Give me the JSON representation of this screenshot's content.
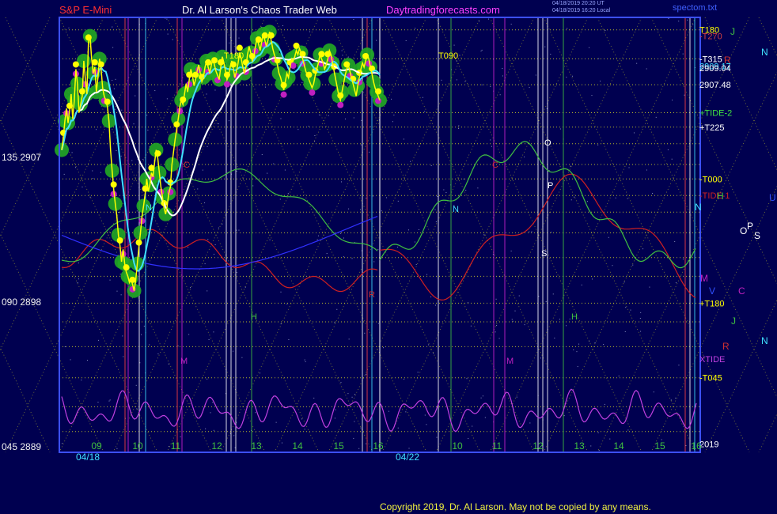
{
  "header": {
    "instrument": "S&P E-Mini",
    "site": "Dr. Al Larson's Chaos Trader Web",
    "url": "Daytradingforecasts.com",
    "stamp1": "04/18/2019 20:20 UT",
    "stamp2": "04/18/2019 16:20 Local",
    "file": "spectom.txt"
  },
  "copyright": "Copyright 2019, Dr. Al Larson. May not be copied by any means.",
  "colors": {
    "background": "#000050",
    "plot_border": "#3c50ff",
    "price_bar": "#ffff00",
    "bubble_green": "#22aa22",
    "bubble_yellow": "#ffff00",
    "bubble_magenta": "#c020c0",
    "ma_white": "#ffffff",
    "ma_cyan": "#40e0ff",
    "tide_red": "#d02020",
    "tide_green": "#40c040",
    "tide_blue": "#3030ff",
    "xtide_magenta": "#c040e0",
    "grid_yellow": "#e0e020"
  },
  "chart_data": {
    "type": "line",
    "title": "S&P E-Mini",
    "left_axis_labels": [
      {
        "price": 2907,
        "text": "135 2907"
      },
      {
        "price": 2898,
        "text": "090 2898"
      },
      {
        "price": 2889,
        "text": "045 2889"
      }
    ],
    "ylim": [
      2889,
      2910
    ],
    "x_dates": [
      "04/18",
      "04/22"
    ],
    "x_hours_day1": [
      "09",
      "10",
      "11",
      "12",
      "13",
      "14",
      "15",
      "16"
    ],
    "x_hours_day2": [
      "10",
      "11",
      "12",
      "13",
      "14",
      "15",
      "16"
    ],
    "right_axis_labels": [
      {
        "text": "T180",
        "price": 2909.4,
        "color": "#ffff00"
      },
      {
        "text": "-T270",
        "price": 2909.1,
        "color": "#d04040"
      },
      {
        "text": "-T315",
        "price": 2908.0,
        "color": "#ffffff"
      },
      {
        "text": "2909.17",
        "price": 2907.65,
        "color": "#40e0ff"
      },
      {
        "text": "2909.04",
        "price": 2907.55,
        "color": "#ffffff"
      },
      {
        "text": "2907.48",
        "price": 2906.75,
        "color": "#ffffff"
      },
      {
        "text": "+TIDE-2",
        "price": 2905.4,
        "color": "#40e040"
      },
      {
        "text": "+T225",
        "price": 2904.7,
        "color": "#ffffff"
      },
      {
        "text": "-T000",
        "price": 2902.2,
        "color": "#ffff00"
      },
      {
        "text": "-TIDE-1",
        "price": 2901.4,
        "color": "#d02020"
      },
      {
        "text": "+T180",
        "price": 2896.2,
        "color": "#ffff00"
      },
      {
        "text": "XTIDE",
        "price": 2893.5,
        "color": "#c040e0"
      },
      {
        "text": "-T045",
        "price": 2892.6,
        "color": "#ffff00"
      },
      {
        "text": "2019",
        "price": 2889.4,
        "color": "#ffffff"
      }
    ],
    "markers_far_right": [
      {
        "text": "J",
        "color": "#40c040"
      },
      {
        "text": "N",
        "color": "#40e0ff"
      },
      {
        "text": "R",
        "color": "#d03030"
      },
      {
        "text": "H",
        "color": "#40c040"
      },
      {
        "text": "U",
        "color": "#3050ff"
      },
      {
        "text": "N",
        "color": "#40e0ff"
      },
      {
        "text": "O",
        "color": "#ffffff"
      },
      {
        "text": "P",
        "color": "#ffffff"
      },
      {
        "text": "S",
        "color": "#ffffff"
      },
      {
        "text": "M",
        "color": "#c020c0"
      },
      {
        "text": "V",
        "color": "#3050ff"
      },
      {
        "text": "C",
        "color": "#c020c0"
      },
      {
        "text": "J",
        "color": "#40c040"
      },
      {
        "text": "N",
        "color": "#40e0ff"
      },
      {
        "text": "R",
        "color": "#d03030"
      }
    ],
    "chart_letters": [
      {
        "text": "T180",
        "color": "#ffff00"
      },
      {
        "text": "T090",
        "color": "#ffff00"
      },
      {
        "text": "C",
        "color": "#d03030"
      },
      {
        "text": "C",
        "color": "#d03030"
      },
      {
        "text": "N",
        "color": "#40e0ff"
      },
      {
        "text": "N",
        "color": "#40e0ff"
      },
      {
        "text": "H",
        "color": "#40c040"
      },
      {
        "text": "H",
        "color": "#40c040"
      },
      {
        "text": "M",
        "color": "#c020c0"
      },
      {
        "text": "M",
        "color": "#c020c0"
      },
      {
        "text": "O",
        "color": "#ffffff"
      },
      {
        "text": "P",
        "color": "#ffffff"
      },
      {
        "text": "S",
        "color": "#ffffff"
      },
      {
        "text": "R",
        "color": "#d03030"
      }
    ],
    "price_bars": {
      "x": [
        0,
        1,
        2,
        3,
        4,
        5,
        6,
        7,
        8,
        9,
        10,
        11,
        12,
        13,
        14,
        15,
        16,
        17,
        18,
        19,
        20,
        21,
        22,
        23,
        24,
        25,
        26,
        27,
        28,
        29,
        30,
        31,
        32,
        33,
        34,
        35,
        36,
        37,
        38,
        39,
        40,
        41,
        42,
        43,
        44,
        45,
        46,
        47,
        48,
        49,
        50,
        51,
        52,
        53,
        54,
        55,
        56,
        57,
        58,
        59,
        60,
        61,
        62,
        63,
        64,
        65,
        66,
        67,
        68,
        69,
        70,
        71,
        72,
        73,
        74,
        75,
        76,
        77,
        78,
        79,
        80,
        81,
        82,
        83,
        84,
        85,
        86,
        87,
        88,
        89,
        90,
        91,
        92,
        93,
        94,
        95,
        96,
        97,
        98,
        99,
        100,
        101,
        102,
        103,
        104,
        105,
        106,
        107,
        108,
        109,
        110,
        111,
        112,
        113,
        114,
        115,
        116,
        117,
        118,
        119,
        120,
        121,
        122,
        123,
        124,
        125,
        126,
        127,
        128,
        129,
        130,
        131,
        132,
        133,
        134,
        135,
        136,
        137,
        138,
        139,
        140,
        141,
        142,
        143,
        144,
        145,
        146,
        147,
        148,
        149,
        150,
        151,
        152,
        153,
        154,
        155,
        156,
        157,
        158,
        159,
        160,
        161,
        162,
        163,
        164,
        165,
        166,
        167,
        168,
        169,
        170,
        171,
        172,
        173,
        174,
        175,
        176,
        177,
        178,
        179,
        180,
        181,
        182,
        183,
        184,
        185,
        186,
        187,
        188,
        189,
        190,
        191,
        192,
        193,
        194,
        195,
        196,
        197,
        198,
        199,
        200
      ],
      "close": [
        2903.6,
        2904.2,
        2905.0,
        2905.6,
        2904.9,
        2905.5,
        2906.3,
        2905.1,
        2906.0,
        2907.5,
        2906.8,
        2905.4,
        2905.8,
        2906.2,
        2907.9,
        2907.0,
        2906.3,
        2908.8,
        2909.1,
        2908.0,
        2907.3,
        2907.6,
        2906.4,
        2907.1,
        2908.0,
        2907.5,
        2906.6,
        2906.2,
        2906.0,
        2905.7,
        2905.0,
        2903.6,
        2902.6,
        2901.7,
        2901.0,
        2900.4,
        2899.5,
        2899.0,
        2898.2,
        2898.8,
        2898.1,
        2897.7,
        2897.5,
        2897.2,
        2897.4,
        2897.1,
        2896.8,
        2897.3,
        2898.1,
        2898.9,
        2899.6,
        2900.4,
        2900.9,
        2901.5,
        2902.2,
        2901.6,
        2901.9,
        2902.5,
        2902.3,
        2903.0,
        2903.6,
        2903.2,
        2902.5,
        2901.8,
        2901.3,
        2900.8,
        2900.5,
        2900.9,
        2901.5,
        2901.8,
        2902.9,
        2903.5,
        2904.1,
        2904.6,
        2905.1,
        2905.7,
        2906.0,
        2905.8,
        2906.3,
        2906.8,
        2906.4,
        2907.0,
        2907.5,
        2907.2,
        2906.7,
        2907.0,
        2907.4,
        2907.7,
        2907.3,
        2906.9,
        2907.1,
        2907.6,
        2907.9,
        2907.6,
        2907.3,
        2907.7,
        2908.0,
        2907.7,
        2907.4,
        2907.2,
        2907.0,
        2907.6,
        2908.1,
        2907.8,
        2907.4,
        2907.0,
        2907.2,
        2907.6,
        2907.9,
        2907.5,
        2907.1,
        2907.4,
        2907.8,
        2908.3,
        2908.0,
        2907.6,
        2907.3,
        2907.6,
        2908.2,
        2908.6,
        2908.3,
        2907.9,
        2908.1,
        2908.6,
        2909.0,
        2908.7,
        2908.4,
        2908.8,
        2909.2,
        2908.9,
        2908.6,
        2908.9,
        2909.3,
        2908.9,
        2908.5,
        2908.2,
        2908.0,
        2907.7,
        2907.3,
        2907.1,
        2906.8,
        2906.5,
        2906.9,
        2907.3,
        2907.1,
        2907.6,
        2908.0,
        2907.9,
        2908.1,
        2908.4,
        2908.2,
        2908.5,
        2908.3,
        2908.0,
        2907.7,
        2907.4,
        2907.2,
        2907.0,
        2906.8,
        2906.6,
        2906.8,
        2907.2,
        2907.5,
        2907.8,
        2908.2,
        2908.0,
        2907.8,
        2907.5,
        2907.7,
        2908.0,
        2908.4,
        2908.2,
        2907.8,
        2907.4,
        2907.0,
        2906.6,
        2906.2,
        2906.0,
        2906.4,
        2906.8,
        2907.2,
        2907.5,
        2907.7,
        2907.4,
        2907.1,
        2906.8,
        2906.5,
        2906.2,
        2906.7,
        2907.1,
        2907.5,
        2907.8,
        2907.6,
        2907.9,
        2908.2,
        2908.0,
        2907.6,
        2907.3,
        2906.9,
        2906.6,
        2906.4,
        2906.2,
        2906.0
      ]
    }
  }
}
